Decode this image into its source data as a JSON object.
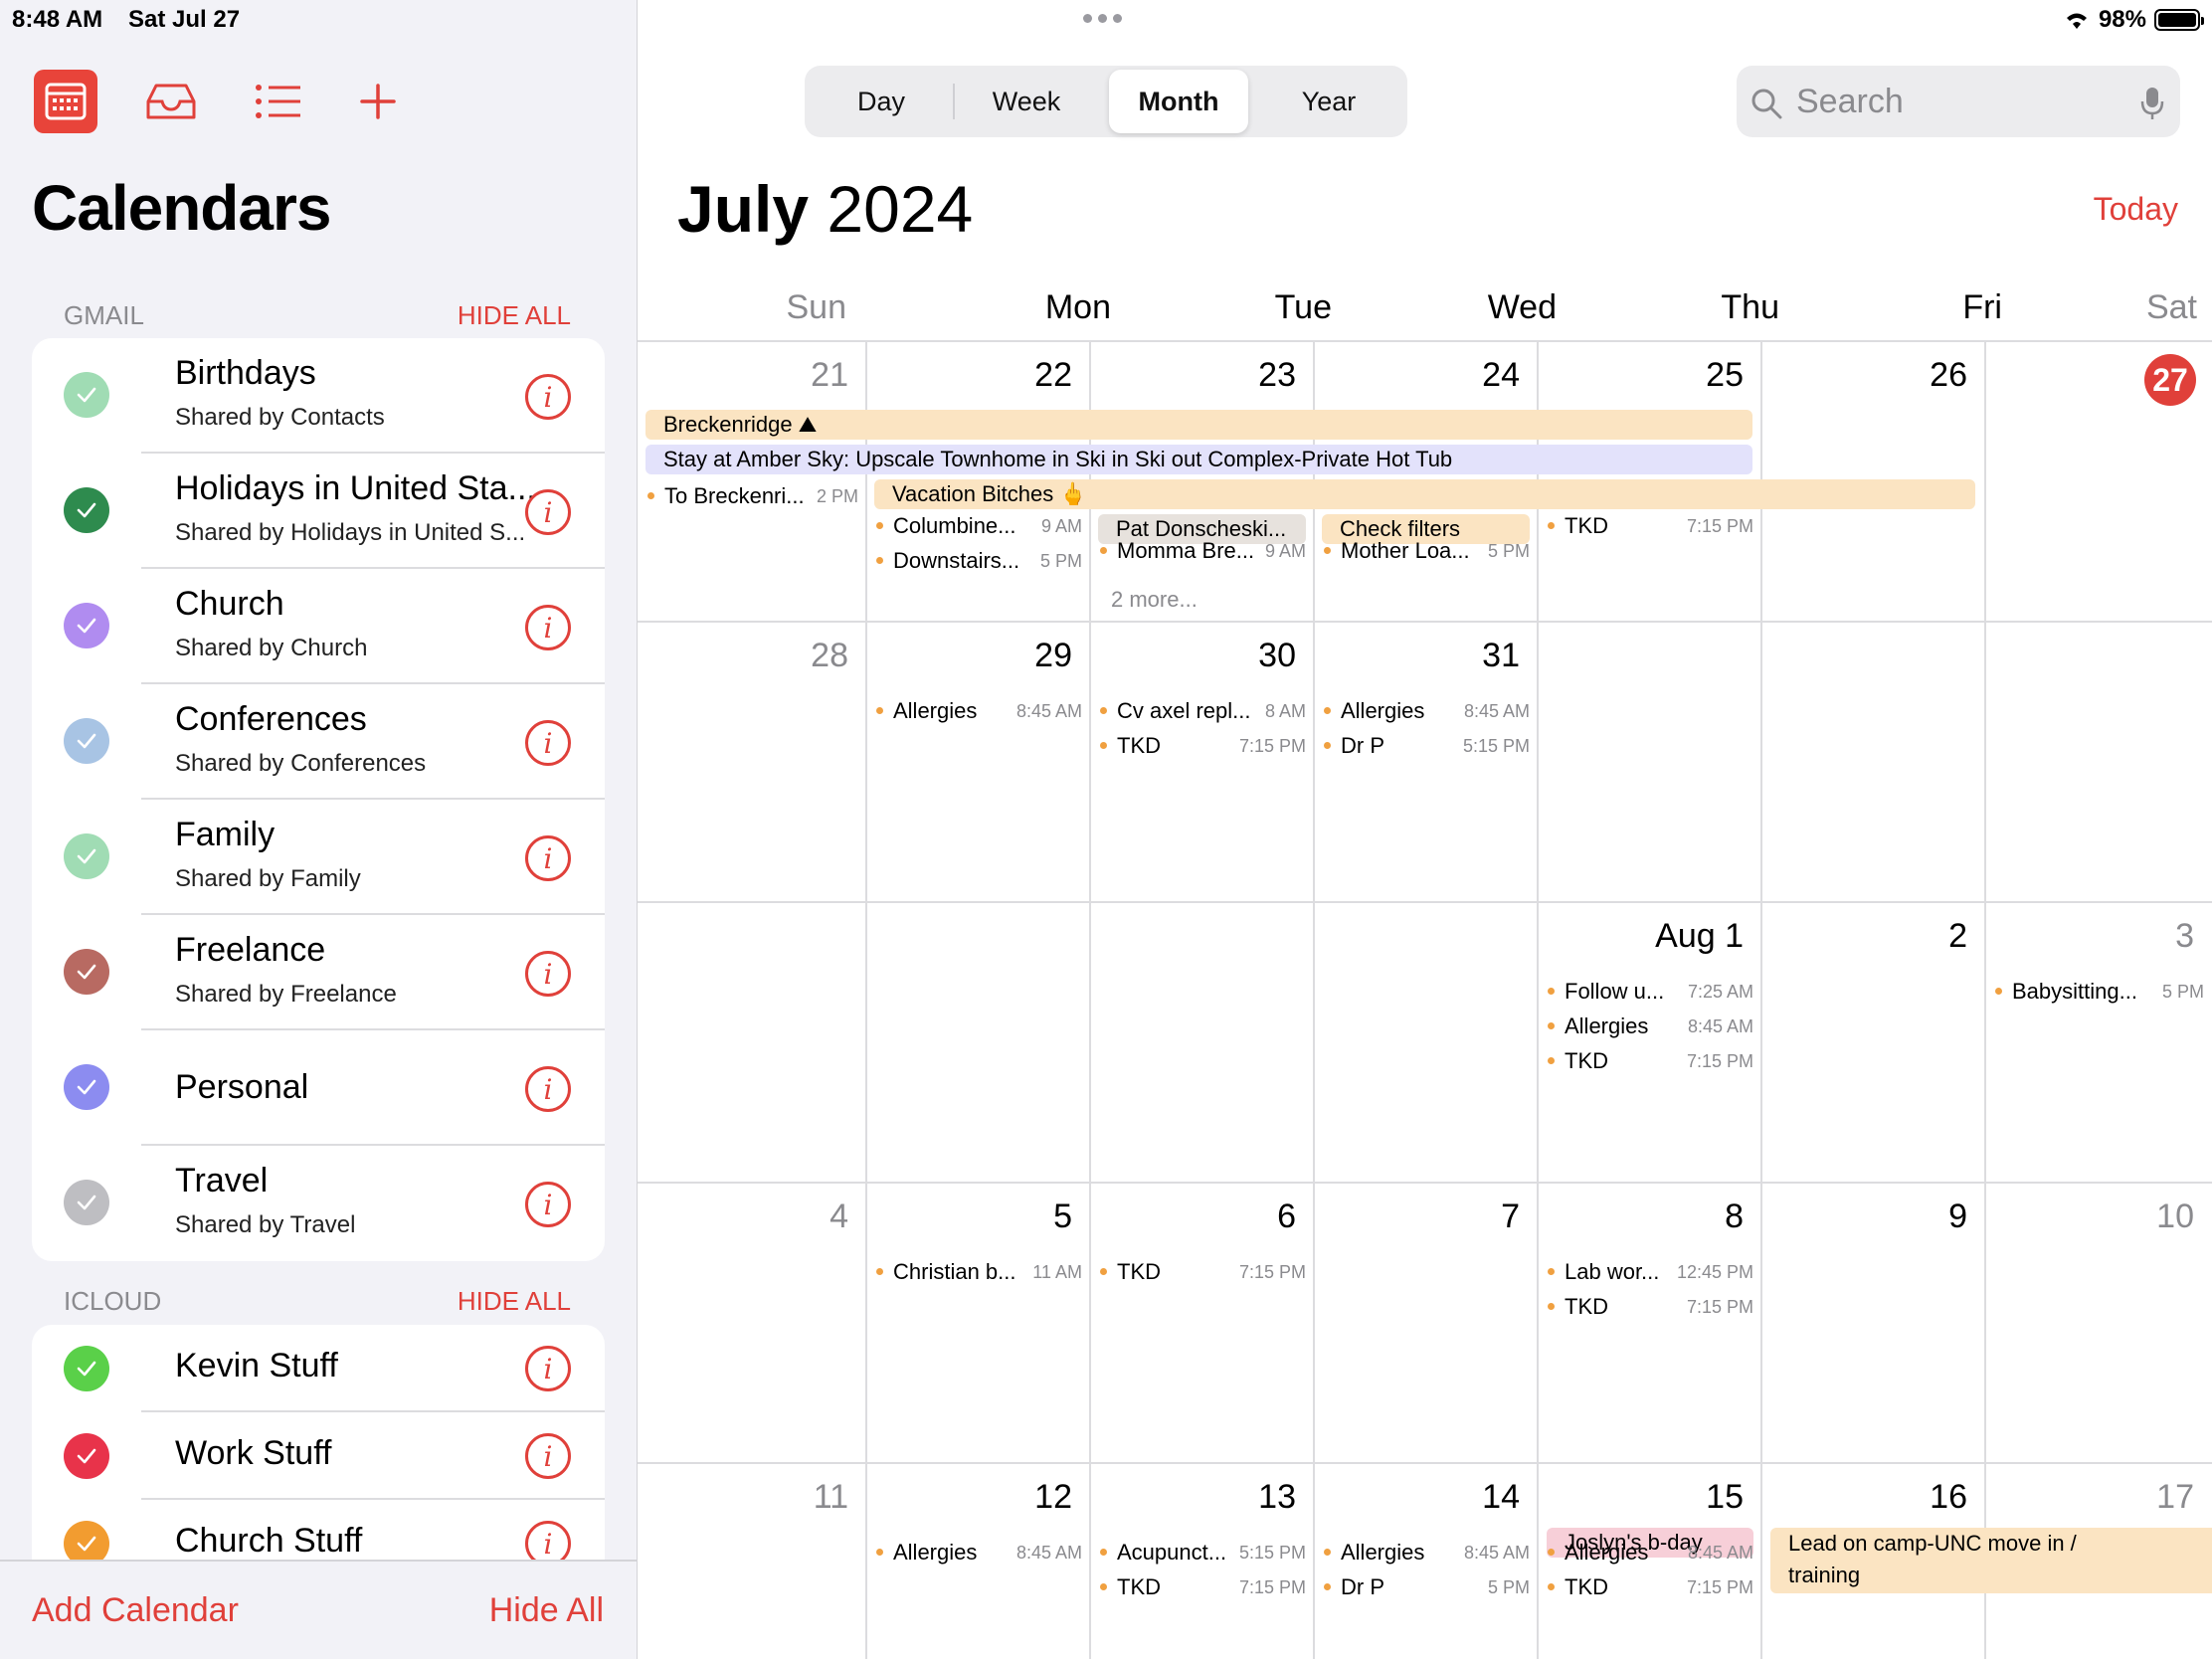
{
  "status": {
    "time": "8:48 AM",
    "date": "Sat Jul 27",
    "battery": "98%"
  },
  "sidebar": {
    "title": "Calendars",
    "sections": [
      {
        "header": "GMAIL",
        "hide_label": "HIDE ALL"
      },
      {
        "header": "ICLOUD",
        "hide_label": "HIDE ALL"
      }
    ],
    "gmail": [
      {
        "name": "Birthdays",
        "sub": "Shared by Contacts",
        "color": "#a0dcb4",
        "filled": true
      },
      {
        "name": "Holidays in United Sta...",
        "sub": "Shared by Holidays in United S...",
        "color": "#2e8b4e",
        "filled": true
      },
      {
        "name": "Church",
        "sub": "Shared by Church",
        "color": "#b08cf0",
        "filled": true
      },
      {
        "name": "Conferences",
        "sub": "Shared by Conferences",
        "color": "#a8c4e4",
        "filled": true
      },
      {
        "name": "Family",
        "sub": "Shared by Family",
        "color": "#a0dcb4",
        "filled": true
      },
      {
        "name": "Freelance",
        "sub": "Shared by Freelance",
        "color": "#b86a62",
        "filled": true
      },
      {
        "name": "Personal",
        "sub": "",
        "color": "#8c8cf0",
        "filled": true
      },
      {
        "name": "Travel",
        "sub": "Shared by Travel",
        "color": "#bebec2",
        "filled": true
      }
    ],
    "icloud": [
      {
        "name": "Kevin Stuff",
        "color": "#5ad049"
      },
      {
        "name": "Work Stuff",
        "color": "#e8334a"
      },
      {
        "name": "Church Stuff",
        "color": "#f29c30"
      }
    ],
    "add_calendar": "Add Calendar",
    "hide_all": "Hide All"
  },
  "toolbar": {
    "calendar_icon": "calendar-grid-icon",
    "inbox_icon": "inbox-icon",
    "list_icon": "list-icon",
    "add_icon": "plus-icon"
  },
  "main": {
    "segments": [
      "Day",
      "Week",
      "Month",
      "Year"
    ],
    "active_segment": "Month",
    "search_placeholder": "Search",
    "month_name": "July",
    "year": "2024",
    "today_label": "Today",
    "weekdays": [
      "Sun",
      "Mon",
      "Tue",
      "Wed",
      "Thu",
      "Fri",
      "Sat"
    ],
    "weeks": [
      [
        "21",
        "22",
        "23",
        "24",
        "25",
        "26",
        "27"
      ],
      [
        "28",
        "29",
        "30",
        "31",
        "",
        "",
        ""
      ],
      [
        "",
        "",
        "",
        "",
        "Aug 1",
        "2",
        "3"
      ],
      [
        "4",
        "5",
        "6",
        "7",
        "8",
        "9",
        "10"
      ],
      [
        "11",
        "12",
        "13",
        "14",
        "15",
        "16",
        "17"
      ]
    ],
    "multi_day": {
      "breckenridge": "Breckenridge ⛰",
      "amber_sky": "Stay at Amber Sky: Upscale Townhome in Ski in Ski out Complex-Private Hot Tub",
      "vacation": "Vacation Bitches 🖕",
      "pat": "Pat Donscheski...",
      "check_filters": "Check filters",
      "joslyn": "Joslyn's b-day",
      "lead": "Lead on camp-UNC move in / training"
    },
    "events": {
      "w1": {
        "sun": [
          {
            "title": "To Breckenri...",
            "time": "2 PM"
          }
        ],
        "mon": [
          {
            "title": "Columbine...",
            "time": "9 AM"
          },
          {
            "title": "Downstairs...",
            "time": "5 PM"
          }
        ],
        "tue": [
          {
            "title": "Momma Bre...",
            "time": "9 AM"
          }
        ],
        "tue_more": "2 more...",
        "wed": [
          {
            "title": "Mother Loa...",
            "time": "5 PM"
          }
        ],
        "thu": [
          {
            "title": "TKD",
            "time": "7:15 PM"
          }
        ]
      },
      "w2": {
        "mon": [
          {
            "title": "Allergies",
            "time": "8:45 AM"
          }
        ],
        "tue": [
          {
            "title": "Cv axel repl...",
            "time": "8 AM"
          },
          {
            "title": "TKD",
            "time": "7:15 PM"
          }
        ],
        "wed": [
          {
            "title": "Allergies",
            "time": "8:45 AM"
          },
          {
            "title": "Dr P",
            "time": "5:15 PM"
          }
        ]
      },
      "w3": {
        "thu": [
          {
            "title": "Follow u...",
            "time": "7:25 AM"
          },
          {
            "title": "Allergies",
            "time": "8:45 AM"
          },
          {
            "title": "TKD",
            "time": "7:15 PM"
          }
        ],
        "sat": [
          {
            "title": "Babysitting...",
            "time": "5 PM"
          }
        ]
      },
      "w4": {
        "mon": [
          {
            "title": "Christian b...",
            "time": "11 AM"
          }
        ],
        "tue": [
          {
            "title": "TKD",
            "time": "7:15 PM"
          }
        ],
        "thu": [
          {
            "title": "Lab wor...",
            "time": "12:45 PM"
          },
          {
            "title": "TKD",
            "time": "7:15 PM"
          }
        ]
      },
      "w5": {
        "mon": [
          {
            "title": "Allergies",
            "time": "8:45 AM"
          }
        ],
        "tue": [
          {
            "title": "Acupunct...",
            "time": "5:15 PM"
          },
          {
            "title": "TKD",
            "time": "7:15 PM"
          }
        ],
        "wed": [
          {
            "title": "Allergies",
            "time": "8:45 AM"
          },
          {
            "title": "Dr P",
            "time": "5 PM"
          }
        ],
        "thu": [
          {
            "title": "Allergies",
            "time": "8:45 AM"
          },
          {
            "title": "TKD",
            "time": "7:15 PM"
          }
        ]
      }
    }
  }
}
